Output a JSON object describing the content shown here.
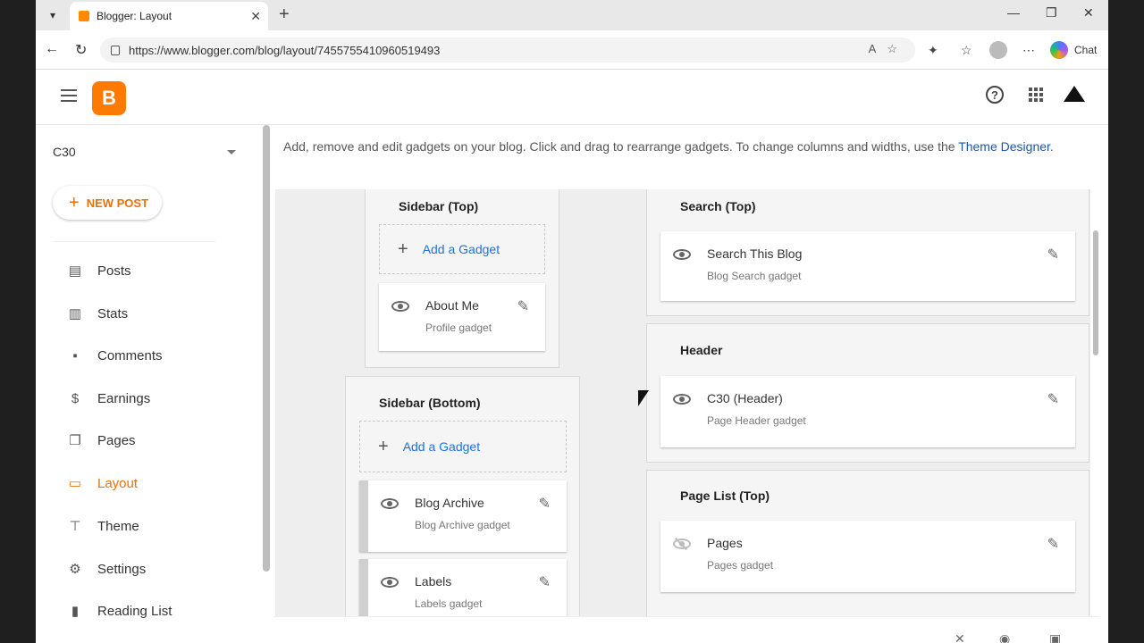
{
  "browser": {
    "tab_title": "Blogger: Layout",
    "url": "https://www.blogger.com/blog/layout/7455755410960519493",
    "chat_label": "Chat"
  },
  "blog_name": "C30",
  "new_post_label": "NEW POST",
  "nav": [
    {
      "label": "Posts",
      "icon": "posts-icon",
      "active": false
    },
    {
      "label": "Stats",
      "icon": "stats-icon",
      "active": false
    },
    {
      "label": "Comments",
      "icon": "comments-icon",
      "active": false
    },
    {
      "label": "Earnings",
      "icon": "dollar-icon",
      "active": false
    },
    {
      "label": "Pages",
      "icon": "pages-icon",
      "active": false
    },
    {
      "label": "Layout",
      "icon": "layout-icon",
      "active": true
    },
    {
      "label": "Theme",
      "icon": "paint-roller-icon",
      "active": false
    },
    {
      "label": "Settings",
      "icon": "gear-icon",
      "active": false
    },
    {
      "label": "Reading List",
      "icon": "bookmark-icon",
      "active": false
    }
  ],
  "description": {
    "text": "Add, remove and edit gadgets on your blog. Click and drag to rearrange gadgets. To change columns and widths, use the ",
    "link": "Theme Designer",
    "suffix": "."
  },
  "sections": {
    "sidebar_top": {
      "title": "Sidebar (Top)",
      "add_label": "Add a Gadget",
      "gadgets": [
        {
          "name": "About Me",
          "type": "Profile gadget"
        }
      ]
    },
    "sidebar_bottom": {
      "title": "Sidebar (Bottom)",
      "add_label": "Add a Gadget",
      "gadgets": [
        {
          "name": "Blog Archive",
          "type": "Blog Archive gadget"
        },
        {
          "name": "Labels",
          "type": "Labels gadget"
        }
      ]
    },
    "search_top": {
      "title": "Search (Top)",
      "gadgets": [
        {
          "name": "Search This Blog",
          "type": "Blog Search gadget"
        }
      ]
    },
    "header": {
      "title": "Header",
      "gadgets": [
        {
          "name": "C30 (Header)",
          "type": "Page Header gadget"
        }
      ]
    },
    "page_list_top": {
      "title": "Page List (Top)",
      "gadgets": [
        {
          "name": "Pages",
          "type": "Pages gadget",
          "hidden": true
        }
      ]
    }
  },
  "colors": {
    "accent": "#e8710a",
    "link": "#1a56a8",
    "blogger_orange": "#ff7a00"
  }
}
